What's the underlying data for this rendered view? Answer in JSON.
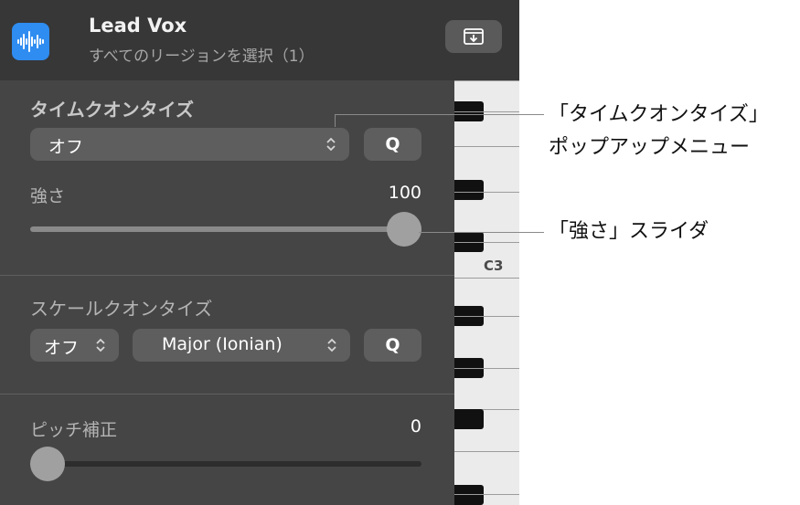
{
  "header": {
    "track_name": "Lead Vox",
    "subtitle": "すべてのリージョンを選択（1）",
    "track_icon": "audio-waveform-icon",
    "export_icon": "download-tray-icon",
    "accent_color": "#2f8cf0"
  },
  "keyboard": {
    "octave_label": "C3"
  },
  "time_quantize": {
    "title": "タイムクオンタイズ",
    "popup_value": "オフ",
    "q_label": "Q",
    "strength_label": "強さ",
    "strength_value": "100",
    "strength_level_percent": 100
  },
  "scale_quantize": {
    "title": "スケールクオンタイズ",
    "mode_value": "オフ",
    "scale_value": "Major (Ionian)",
    "q_label": "Q"
  },
  "pitch_correction": {
    "label": "ピッチ補正",
    "value": "0",
    "level_percent": 0
  },
  "callouts": {
    "popup_line1": "「タイムクオンタイズ」",
    "popup_line2": "ポップアップメニュー",
    "slider": "「強さ」スライダ"
  }
}
